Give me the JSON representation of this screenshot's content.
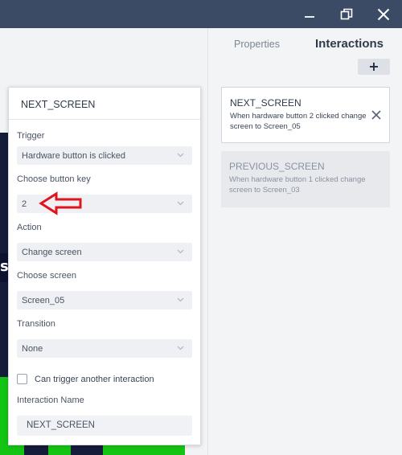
{
  "titlebar": {
    "buttons": [
      {
        "name": "minimize-icon"
      },
      {
        "name": "restore-icon"
      },
      {
        "name": "close-icon"
      }
    ]
  },
  "canvas": {
    "partial_letter": "s"
  },
  "tabs": {
    "properties": "Properties",
    "interactions": "Interactions"
  },
  "add_button": "+",
  "interactions": [
    {
      "name": "NEXT_SCREEN",
      "description": "When hardware button 2 clicked change screen to Screen_05",
      "selected": true
    },
    {
      "name": "PREVIOUS_SCREEN",
      "description": "When hardware button 1 clicked change screen to Screen_03",
      "selected": false
    }
  ],
  "editor": {
    "title": "NEXT_SCREEN",
    "trigger_label": "Trigger",
    "trigger_value": "Hardware button is clicked",
    "button_key_label": "Choose button key",
    "button_key_value": "2",
    "action_label": "Action",
    "action_value": "Change screen",
    "screen_label": "Choose screen",
    "screen_value": "Screen_05",
    "transition_label": "Transition",
    "transition_value": "None",
    "checkbox_label": "Can trigger another interaction",
    "checkbox_checked": false,
    "name_label": "Interaction Name",
    "name_value": "NEXT_SCREEN"
  },
  "colors": {
    "titlebar": "#3c4b65",
    "annotation_arrow": "#e0141e",
    "canvas_dark": "#141c3a",
    "canvas_green": "#14c414"
  }
}
